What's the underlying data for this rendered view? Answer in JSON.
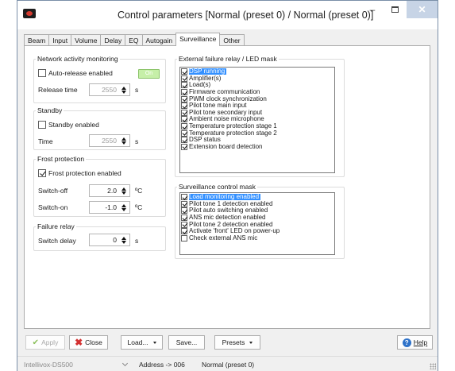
{
  "window": {
    "title": "Control parameters [Normal (preset 0) / Normal (preset 0)]",
    "minimize_glyph": "–",
    "close_glyph": "✕"
  },
  "tabs": [
    {
      "label": "Beam"
    },
    {
      "label": "Input"
    },
    {
      "label": "Volume"
    },
    {
      "label": "Delay"
    },
    {
      "label": "EQ"
    },
    {
      "label": "Autogain"
    },
    {
      "label": "Surveillance",
      "active": true
    },
    {
      "label": "Other"
    }
  ],
  "network": {
    "legend": "Network activity monitoring",
    "auto_release_label": "Auto-release enabled",
    "auto_release_checked": false,
    "on_button": "On",
    "release_time_label": "Release time",
    "release_time_value": "2550",
    "release_time_unit": "s"
  },
  "standby": {
    "legend": "Standby",
    "enabled_label": "Standby enabled",
    "enabled_checked": false,
    "time_label": "Time",
    "time_value": "2550",
    "time_unit": "s"
  },
  "frost": {
    "legend": "Frost protection",
    "enabled_label": "Frost protection enabled",
    "enabled_checked": true,
    "switch_off_label": "Switch-off",
    "switch_off_value": "2.0",
    "switch_on_label": "Switch-on",
    "switch_on_value": "-1.0",
    "unit": "ºC"
  },
  "failure_relay": {
    "legend": "Failure relay",
    "delay_label": "Switch delay",
    "delay_value": "0",
    "delay_unit": "s"
  },
  "external_failure": {
    "legend": "External failure relay / LED mask",
    "items": [
      {
        "label": "DSP running",
        "checked": true,
        "selected": true
      },
      {
        "label": "Amplifier(s)",
        "checked": true
      },
      {
        "label": "Load(s)",
        "checked": true
      },
      {
        "label": "Firmware communication",
        "checked": true
      },
      {
        "label": "PWM clock synchronization",
        "checked": true
      },
      {
        "label": "Pilot tone main input",
        "checked": true
      },
      {
        "label": "Pilot tone secondary input",
        "checked": true
      },
      {
        "label": "Ambient noise microphone",
        "checked": true
      },
      {
        "label": "Temperature protection stage 1",
        "checked": true
      },
      {
        "label": "Temperature protection stage 2",
        "checked": true
      },
      {
        "label": "DSP status",
        "checked": true
      },
      {
        "label": "Extension board detection",
        "checked": true
      }
    ]
  },
  "surveillance_mask": {
    "legend": "Surveillance control mask",
    "items": [
      {
        "label": "Load monitoring enabled",
        "checked": true,
        "selected": true
      },
      {
        "label": "Pilot tone 1 detection enabled",
        "checked": true
      },
      {
        "label": "Pilot auto switching enabled",
        "checked": true
      },
      {
        "label": "ANS mic detection enabled",
        "checked": true
      },
      {
        "label": "Pilot tone 2 detection enabled",
        "checked": true
      },
      {
        "label": "Activate 'front' LED on power-up",
        "checked": true
      },
      {
        "label": "Check external ANS mic",
        "checked": false
      }
    ]
  },
  "buttons": {
    "apply": "Apply",
    "close": "Close",
    "load": "Load...",
    "save": "Save...",
    "presets": "Presets",
    "help": "Help",
    "help_glyph": "?",
    "check_glyph": "✔",
    "close_glyph": "✖"
  },
  "status": {
    "device": "Intellivox-DS500",
    "address": "Address -> 006",
    "preset": "Normal (preset 0)"
  },
  "colors": {
    "selection": "#3390ff",
    "on_button": "#c6efa8",
    "close_button": "#c7d4e6"
  }
}
